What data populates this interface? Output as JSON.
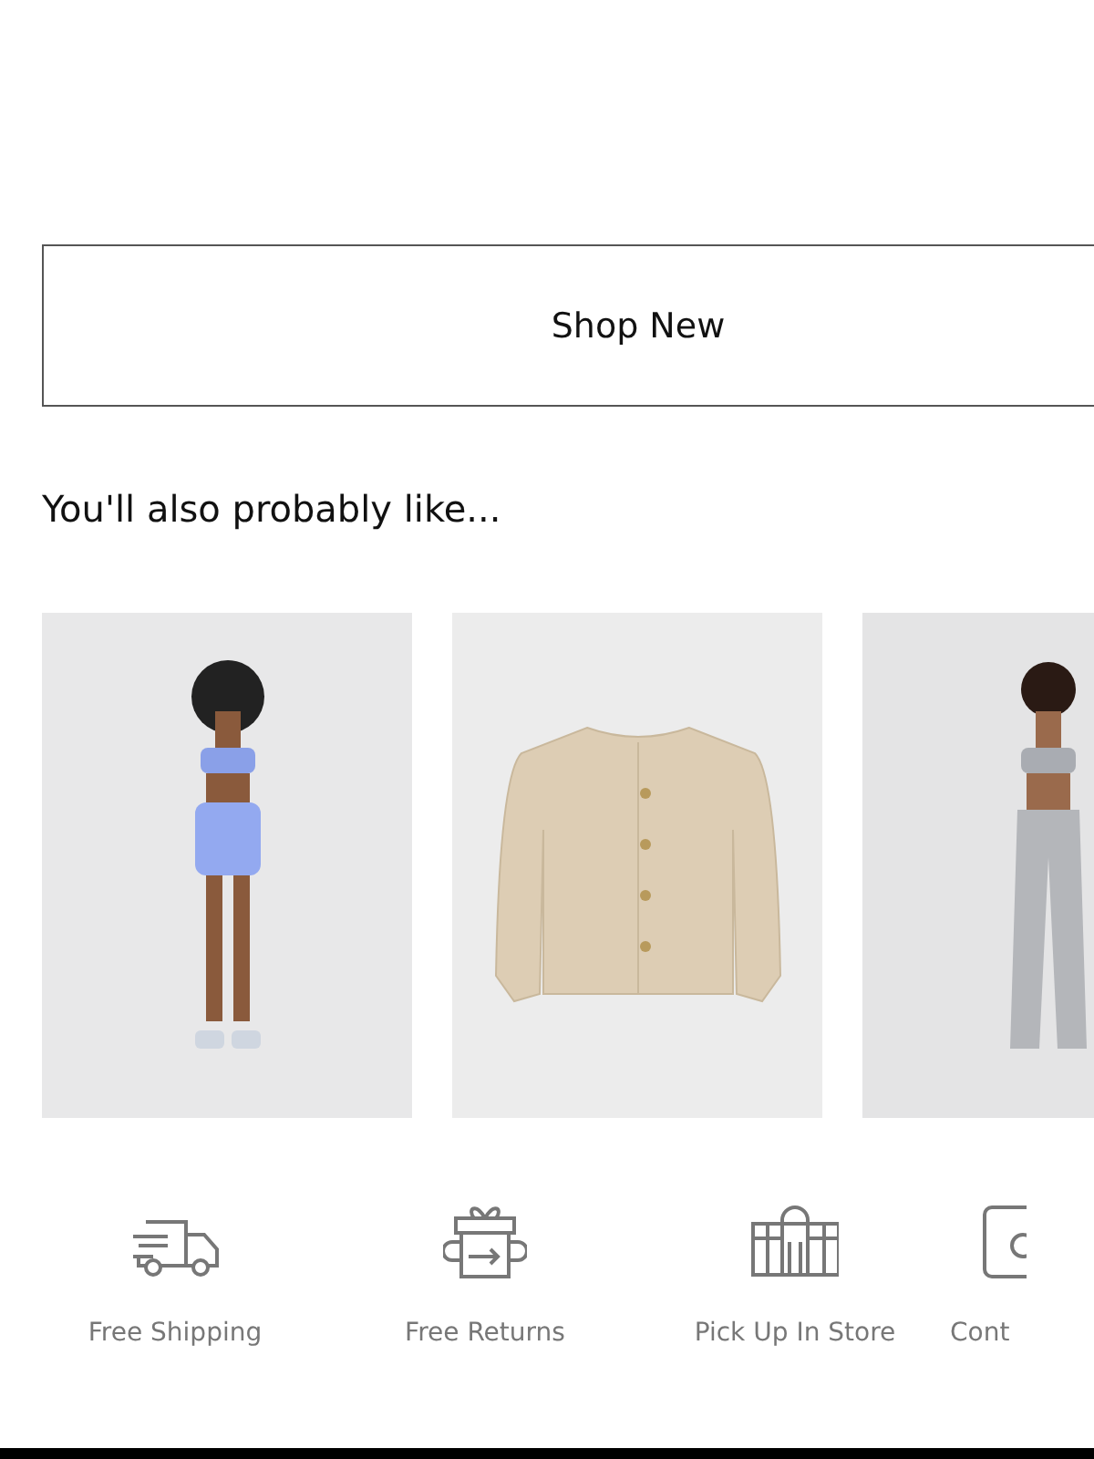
{
  "button": {
    "label": "Shop New"
  },
  "recommendations": {
    "heading": "You'll also probably like...",
    "products": [
      {
        "kind": "model-blue"
      },
      {
        "kind": "cardigan"
      },
      {
        "kind": "model-grey"
      }
    ]
  },
  "perks": [
    {
      "kind": "truck",
      "label": "Free Shipping"
    },
    {
      "kind": "gift",
      "label": "Free Returns"
    },
    {
      "kind": "store",
      "label": "Pick Up In Store"
    },
    {
      "kind": "phone",
      "label": "Cont"
    }
  ]
}
